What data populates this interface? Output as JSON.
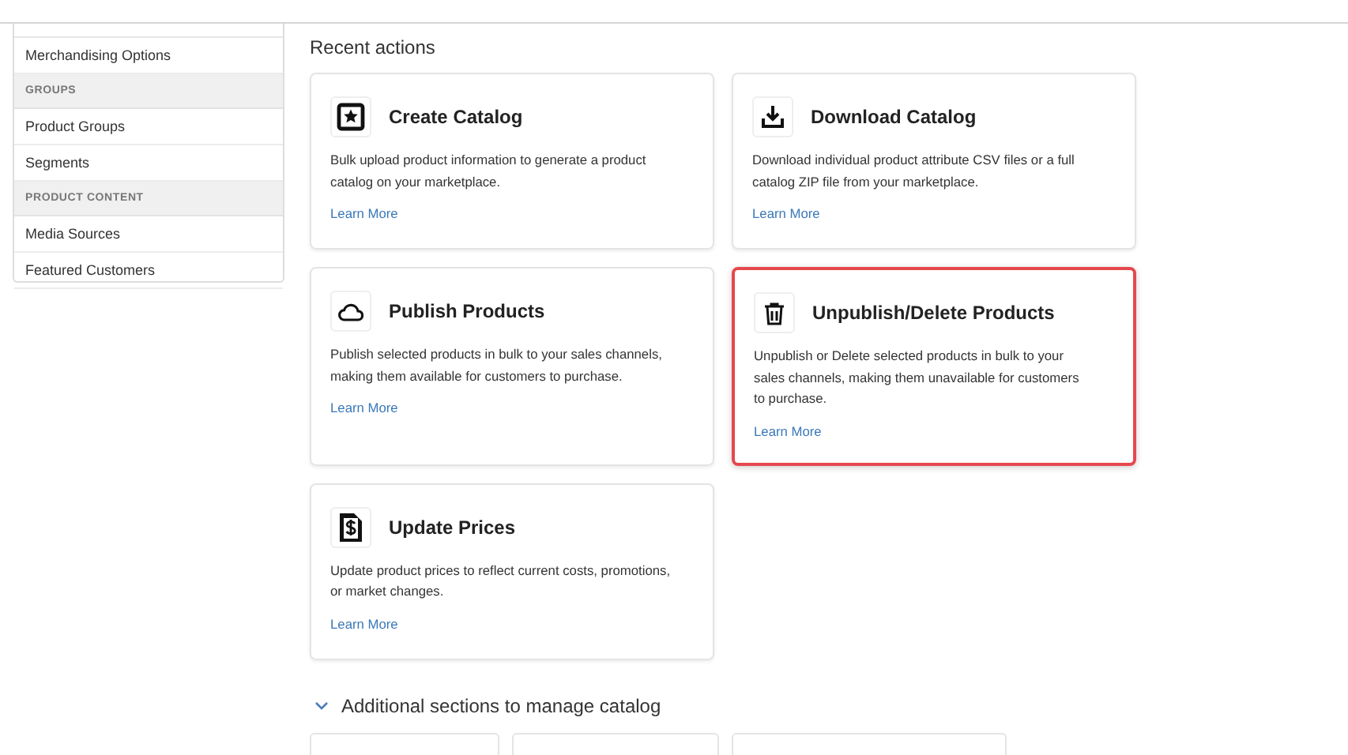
{
  "sidebar": {
    "items": [
      {
        "kind": "item",
        "label": "Merchandising Options"
      },
      {
        "kind": "header",
        "label": "GROUPS"
      },
      {
        "kind": "item",
        "label": "Product Groups"
      },
      {
        "kind": "item",
        "label": "Segments"
      },
      {
        "kind": "header",
        "label": "PRODUCT CONTENT"
      },
      {
        "kind": "item",
        "label": "Media Sources"
      },
      {
        "kind": "item",
        "label": "Featured Customers"
      }
    ]
  },
  "recent_actions": {
    "heading": "Recent actions",
    "cards": [
      {
        "kind": "star",
        "title": "Create Catalog",
        "description": "Bulk upload product information to generate a product catalog on your marketplace.",
        "link": "Learn More",
        "highlighted": false
      },
      {
        "kind": "download",
        "title": "Download Catalog",
        "description": "Download individual product attribute CSV files or a full catalog ZIP file from your marketplace.",
        "link": "Learn More",
        "highlighted": false
      },
      {
        "kind": "cloud",
        "title": "Publish Products",
        "description": "Publish selected products in bulk to your sales channels, making them available for customers to purchase.",
        "link": "Learn More",
        "highlighted": false
      },
      {
        "kind": "trash",
        "title": "Unpublish/Delete Products",
        "description": "Unpublish or Delete selected products in bulk to your sales channels, making them unavailable for customers to purchase.",
        "link": "Learn More",
        "highlighted": true
      },
      {
        "kind": "dollar",
        "title": "Update Prices",
        "description": "Update product prices to reflect current costs, promotions, or market changes.",
        "link": "Learn More",
        "highlighted": false
      }
    ]
  },
  "additional_sections": {
    "heading": "Additional sections to manage catalog",
    "expanded": true
  }
}
